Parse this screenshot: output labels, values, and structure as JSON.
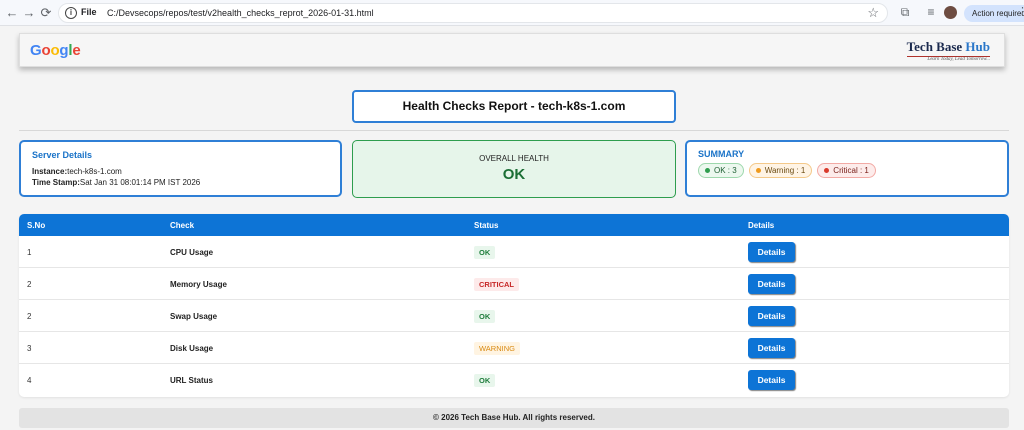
{
  "browser": {
    "file_label": "File",
    "url": "C:/Devsecops/repos/test/v2health_checks_reprot_2026-01-31.html",
    "action_required": "Action required"
  },
  "header": {
    "google_logo": [
      "G",
      "o",
      "o",
      "g",
      "l",
      "e"
    ],
    "google_colors": [
      "#4285F4",
      "#EA4335",
      "#FBBC05",
      "#4285F4",
      "#34A853",
      "#EA4335"
    ],
    "brand_name_main": "Tech Base ",
    "brand_name_accent": "Hub",
    "brand_tagline": "Learn Today, Lead Tomorrow..."
  },
  "title": "Health Checks Report - tech-k8s-1.com",
  "server": {
    "heading": "Server Details",
    "instance_label": "Instance:",
    "instance_value": "tech-k8s-1.com",
    "timestamp_label": "Time Stamp:",
    "timestamp_value": "Sat Jan 31 08:01:14 PM IST 2026"
  },
  "overall": {
    "label": "OVERALL HEALTH",
    "value": "OK"
  },
  "summary": {
    "heading": "SUMMARY",
    "ok": "OK : 3",
    "warning": "Warning : 1",
    "critical": "Critical : 1"
  },
  "table": {
    "headers": [
      "S.No",
      "Check",
      "Status",
      "Details"
    ],
    "rows": [
      {
        "sno": "1",
        "check": "CPU Usage",
        "status": "OK",
        "status_kind": "ok",
        "details": "Details"
      },
      {
        "sno": "2",
        "check": "Memory Usage",
        "status": "CRITICAL",
        "status_kind": "critical",
        "details": "Details"
      },
      {
        "sno": "2",
        "check": "Swap Usage",
        "status": "OK",
        "status_kind": "ok",
        "details": "Details"
      },
      {
        "sno": "3",
        "check": "Disk Usage",
        "status": "WARNING",
        "status_kind": "warning",
        "details": "Details"
      },
      {
        "sno": "4",
        "check": "URL Status",
        "status": "OK",
        "status_kind": "ok",
        "details": "Details"
      }
    ]
  },
  "footer": "© 2026 Tech Base Hub. All rights reserved.",
  "icons": {
    "back": "arrow-left-icon",
    "forward": "arrow-right-icon",
    "reload": "reload-icon",
    "info": "info-icon",
    "star": "star-icon",
    "extensions": "puzzle-icon",
    "media": "media-queue-icon",
    "profile": "avatar-icon",
    "menu": "kebab-menu-icon"
  }
}
